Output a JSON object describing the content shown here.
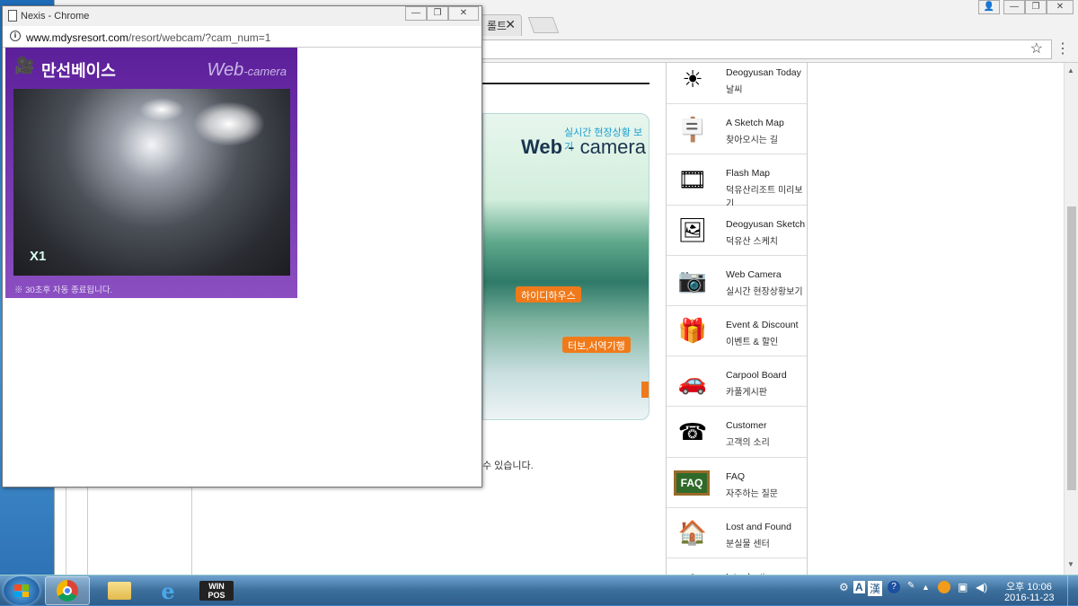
{
  "main_window": {
    "tab_label": "롤트",
    "tab_close": "✕",
    "win_controls": {
      "user": "👤",
      "minimize": "—",
      "restore": "❐",
      "close": "✕"
    },
    "star": "☆",
    "menu": "⋮"
  },
  "promo": {
    "subtitle": "실시간 현장상황 보기",
    "title_main": "Web",
    "title_rest": " - camera",
    "tag1": "하이디하우스",
    "tag2": "터보,서역기행"
  },
  "page_text": "수 있습니다.",
  "side_menu": [
    {
      "en": "Deogyusan Today",
      "ko": "날씨",
      "icon": "☀",
      "icon_name": "sun-icon"
    },
    {
      "en": "A Sketch Map",
      "ko": "찾아오시는 길",
      "icon": "🪧",
      "icon_name": "signpost-icon"
    },
    {
      "en": "Flash Map",
      "ko": "덕유산리조트 미리보기",
      "icon": "🎞",
      "icon_name": "film-reel-icon"
    },
    {
      "en": "Deogyusan Sketch",
      "ko": "덕유산 스케치",
      "icon": "🖼",
      "icon_name": "photos-icon"
    },
    {
      "en": "Web Camera",
      "ko": "실시간 현장상황보기",
      "icon": "📷",
      "icon_name": "webcam-icon"
    },
    {
      "en": "Event & Discount",
      "ko": "이벤트 & 할인",
      "icon": "🎁",
      "icon_name": "gift-icon"
    },
    {
      "en": "Carpool Board",
      "ko": "카풀게시판",
      "icon": "🚗",
      "icon_name": "car-icon"
    },
    {
      "en": "Customer",
      "ko": "고객의 소리",
      "icon": "☎",
      "icon_name": "telephone-icon"
    },
    {
      "en": "FAQ",
      "ko": "자주하는 질문",
      "icon": "FAQ",
      "icon_name": "faq-board-icon"
    },
    {
      "en": "Lost and Found",
      "ko": "분실물 센터",
      "icon": "🏠",
      "icon_name": "lost-found-icon"
    },
    {
      "en": "Introduction",
      "ko": "",
      "icon": "✿",
      "icon_name": "introduction-icon"
    }
  ],
  "popup": {
    "title": "Nexis - Chrome",
    "url_domain": "www.mdysresort.com",
    "url_path": "/resort/webcam/?cam_num=1",
    "controls": {
      "minimize": "—",
      "restore": "❐",
      "close": "✕"
    },
    "cam_title": "만선베이스",
    "cam_web": "Web",
    "cam_web_rest": "-camera",
    "zoom": "X1",
    "note": "※ 30초후 자동 종료됩니다."
  },
  "taskbar": {
    "winpos_label": "WIN POS",
    "tray": {
      "ime_a": "A",
      "ime_han": "漢",
      "help": "?",
      "time": "오후 10:06",
      "date": "2016-11-23"
    }
  }
}
